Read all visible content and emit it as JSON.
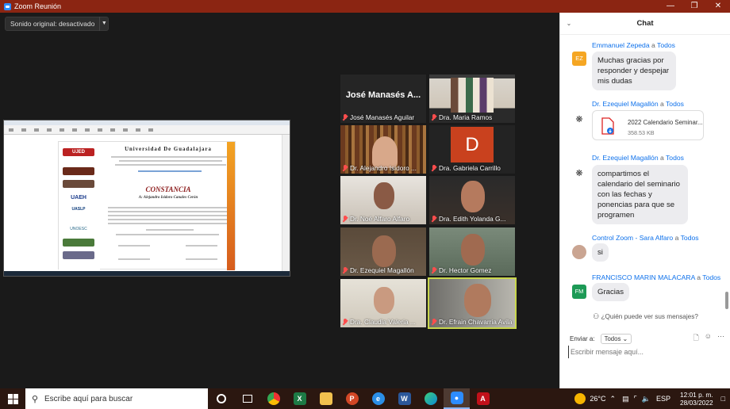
{
  "window": {
    "title": "Zoom Reunión"
  },
  "toolbar": {
    "sound_label": "Sonido original: desactivado"
  },
  "document": {
    "university": "Universidad De Guadalajara",
    "certificate_title": "CONSTANCIA",
    "recipient": "A: Alejandro Isidoro Canales Cerón",
    "logo_labels": [
      "UJED",
      "UAEH",
      "UASLP",
      "UNOESC"
    ]
  },
  "participants": [
    {
      "name": "José Manasés Aguilar",
      "big_name": "José Manasés A...",
      "muted": true
    },
    {
      "name": "Dra. Maria Ramos",
      "muted": true
    },
    {
      "name": "Dr. Alejandro Isidoro ...",
      "muted": true
    },
    {
      "name": "Dra. Gabriela Carrillo",
      "letter": "D",
      "muted": true
    },
    {
      "name": "Dr. Noé Alfaro Alfaro",
      "muted": true
    },
    {
      "name": "Dra. Edith Yolanda G...",
      "muted": true
    },
    {
      "name": "Dr. Ezequiel Magallón",
      "muted": true
    },
    {
      "name": "Dr. Hector Gomez",
      "muted": true
    },
    {
      "name": "Dra. Claudia Valeria ...",
      "muted": true
    },
    {
      "name": "Dr. Efrain Chavarria Avila",
      "muted": true,
      "active": true
    }
  ],
  "chat": {
    "title": "Chat",
    "to_word": "a",
    "messages": [
      {
        "from": "Emmanuel Zepeda",
        "to": "Todos",
        "initials": "EZ",
        "avatar_color": "#f5a623",
        "text": "Muchas gracias por responder y despejar mis dudas"
      },
      {
        "from": "Dr. Ezequiel Magallón",
        "to": "Todos",
        "file_name": "2022 Calendario Seminar...",
        "file_size": "358.53 KB"
      },
      {
        "from": "Dr. Ezequiel Magallón",
        "to": "Todos",
        "text": "compartimos el calendario del seminario con las fechas y ponencias para que se programen"
      },
      {
        "from": "Control Zoom - Sara Alfaro",
        "to": "Todos",
        "text": "si"
      },
      {
        "from": "FRANCISCO MARIN MALACARA",
        "to": "Todos",
        "initials": "FM",
        "avatar_color": "#1d9a56",
        "text": "Gracias"
      }
    ],
    "who_can_see": "¿Quién puede ver sus mensajes?",
    "send_to_label": "Enviar a:",
    "send_to_value": "Todos",
    "input_placeholder": "Escribir mensaje aquí..."
  },
  "taskbar": {
    "search_placeholder": "Escribe aquí para buscar",
    "weather": "26°C",
    "language": "ESP",
    "time": "12:01 p. m.",
    "date": "28/03/2022",
    "apps": [
      "task-view",
      "chrome",
      "excel",
      "files",
      "powerpoint",
      "edge",
      "word",
      "edge-dev",
      "zoom",
      "acrobat"
    ]
  }
}
